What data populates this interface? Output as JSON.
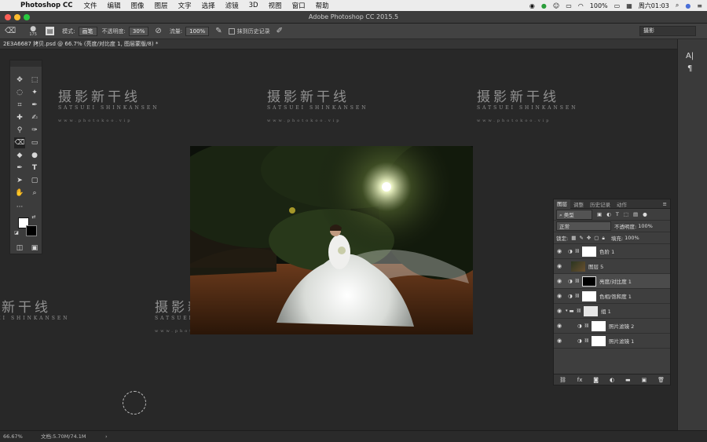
{
  "menubar": {
    "app": "Photoshop CC",
    "items": [
      "文件",
      "编辑",
      "图像",
      "图层",
      "文字",
      "选择",
      "滤镜",
      "3D",
      "视图",
      "窗口",
      "帮助"
    ],
    "battery": "100%",
    "clock": "周六01:03"
  },
  "window": {
    "title": "Adobe Photoshop CC 2015.5"
  },
  "options": {
    "brush_size": "175",
    "mode_label": "模式:",
    "mode_value": "画笔",
    "opacity_label": "不透明度:",
    "opacity_value": "30%",
    "flow_label": "流量:",
    "flow_value": "100%",
    "erase_history_label": "抹到历史记录",
    "workspace": "摄影"
  },
  "document": {
    "tab_title": "2E3A6687 拷贝.psd @ 66.7% (亮度/对比度 1, 图层蒙版/8) *"
  },
  "watermark": {
    "title": "摄影新干线",
    "subtitle": "SATSUEI SHINKANSEN",
    "url": "www.photokoo.vip"
  },
  "layers_panel": {
    "tabs": [
      "图层",
      "调整",
      "历史记录",
      "动作"
    ],
    "filter_kind": "类型",
    "blend_mode": "正常",
    "opacity_label": "不透明度:",
    "opacity_value": "100%",
    "lock_label": "锁定:",
    "fill_label": "填充:",
    "fill_value": "100%",
    "layers": [
      {
        "name": "色阶 1"
      },
      {
        "name": "图层 5"
      },
      {
        "name": "亮度/对比度 1"
      },
      {
        "name": "色相/饱和度 1"
      },
      {
        "name": "组 1"
      },
      {
        "name": "照片滤镜 2"
      },
      {
        "name": "照片滤镜 1"
      }
    ]
  },
  "status": {
    "zoom": "66.67%",
    "doc_size": "文档:5.70M/74.1M"
  },
  "right_strip": {
    "char_glyph": "A|",
    "para_glyph": "¶"
  }
}
